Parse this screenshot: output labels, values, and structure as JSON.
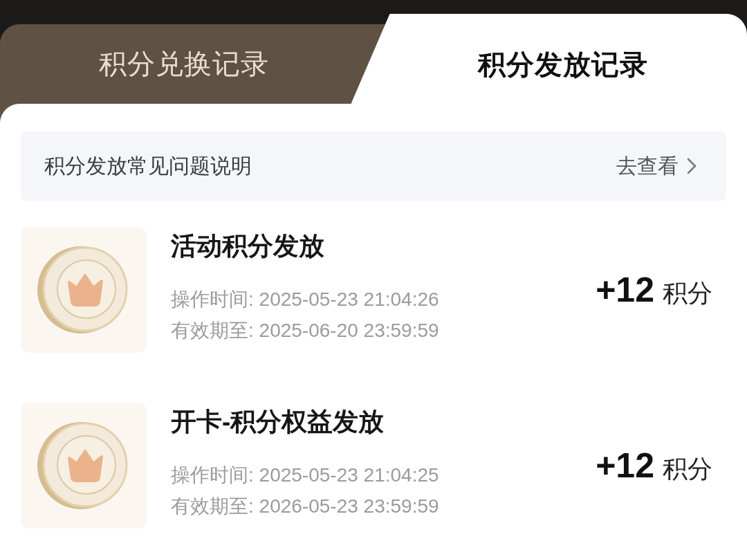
{
  "tabs": [
    {
      "label": "积分兑换记录",
      "selected": false
    },
    {
      "label": "积分发放记录",
      "selected": true
    }
  ],
  "faq_banner": {
    "text": "积分发放常见问题说明",
    "link": "去查看"
  },
  "records": [
    {
      "title": "活动积分发放",
      "operated_at": "操作时间: 2025-05-23 21:04:26",
      "valid_until": "有效期至: 2025-06-20 23:59:59",
      "points": "+12",
      "unit": "积分"
    },
    {
      "title": "开卡-积分权益发放",
      "operated_at": "操作时间: 2025-05-23 21:04:25",
      "valid_until": "有效期至: 2026-05-23 23:59:59",
      "points": "+12",
      "unit": "积分"
    }
  ]
}
